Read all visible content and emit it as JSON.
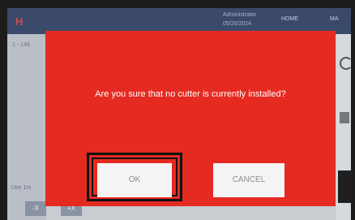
{
  "background_ui": {
    "logo": "H",
    "user": "Administrator",
    "date": "05/20/2014",
    "home_tab": "HOME",
    "right_tab": "MA",
    "counter": "1 - 148",
    "use_label": "Use 1m",
    "bottom_buttons": [
      "-X",
      "+X"
    ]
  },
  "dialog": {
    "message": "Are you sure that no cutter is currently installed?",
    "ok_label": "OK",
    "cancel_label": "CANCEL"
  },
  "colors": {
    "dialog_background": "#e52a21",
    "button_background": "#f4f4f4",
    "highlight_frame": "#111111"
  }
}
